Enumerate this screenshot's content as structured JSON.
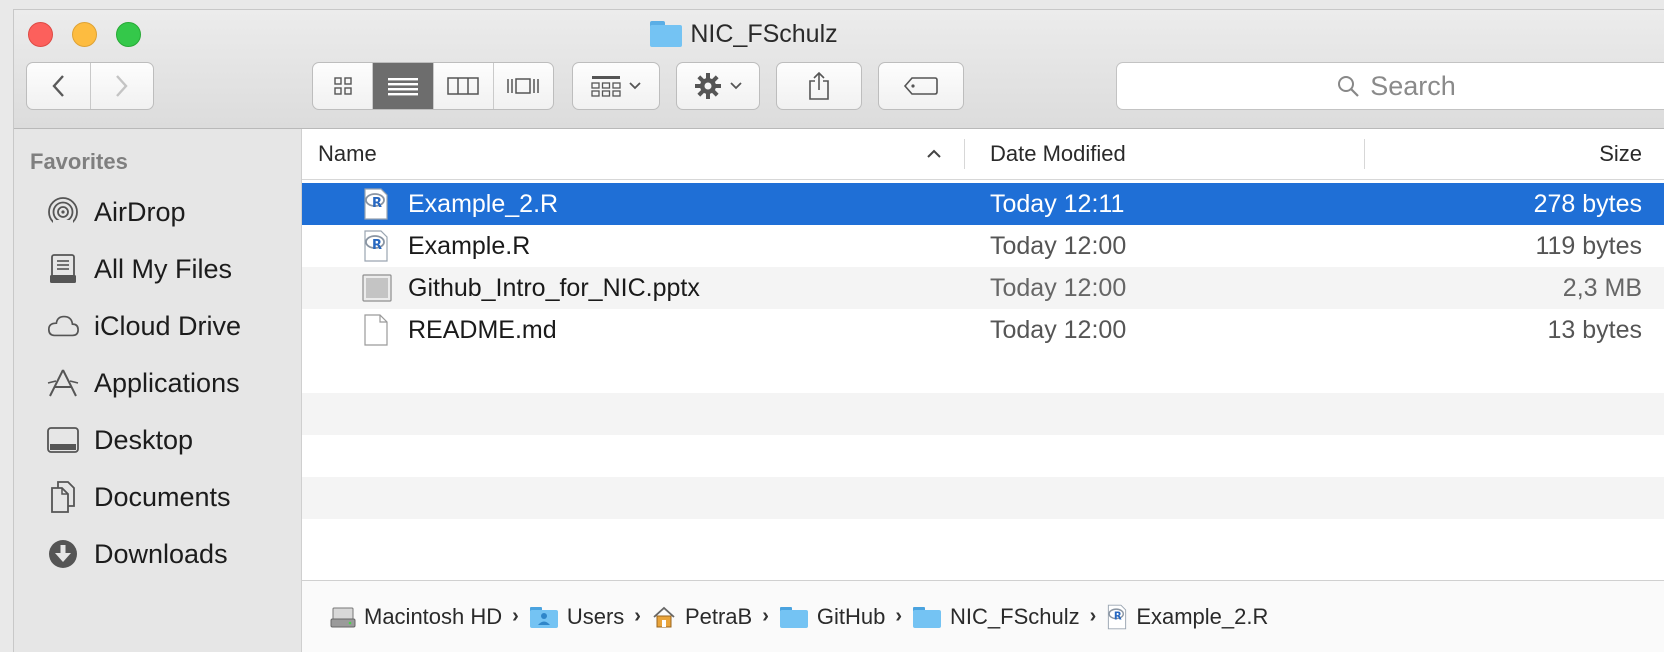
{
  "window": {
    "title": "NIC_FSchulz"
  },
  "toolbar": {
    "back_icon": "chevron-left-icon",
    "forward_icon": "chevron-right-icon",
    "view_modes": [
      "icon-view",
      "list-view",
      "column-view",
      "cover-flow-view"
    ],
    "active_view": "list-view",
    "search_placeholder": "Search"
  },
  "sidebar": {
    "heading": "Favorites",
    "items": [
      {
        "label": "AirDrop",
        "icon": "airdrop-icon"
      },
      {
        "label": "All My Files",
        "icon": "all-my-files-icon"
      },
      {
        "label": "iCloud Drive",
        "icon": "icloud-icon"
      },
      {
        "label": "Applications",
        "icon": "applications-icon"
      },
      {
        "label": "Desktop",
        "icon": "desktop-icon"
      },
      {
        "label": "Documents",
        "icon": "documents-icon"
      },
      {
        "label": "Downloads",
        "icon": "downloads-icon"
      }
    ]
  },
  "columns": {
    "name": "Name",
    "date": "Date Modified",
    "size": "Size",
    "sort_indicator": "^"
  },
  "files": [
    {
      "name": "Example_2.R",
      "date": "Today 12:11",
      "size": "278 bytes",
      "icon": "r-file-icon",
      "selected": true
    },
    {
      "name": "Example.R",
      "date": "Today 12:00",
      "size": "119 bytes",
      "icon": "r-file-icon",
      "selected": false
    },
    {
      "name": "Github_Intro_for_NIC.pptx",
      "date": "Today 12:00",
      "size": "2,3 MB",
      "icon": "pptx-file-icon",
      "selected": false
    },
    {
      "name": "README.md",
      "date": "Today 12:00",
      "size": "13 bytes",
      "icon": "document-file-icon",
      "selected": false
    }
  ],
  "pathbar": {
    "items": [
      {
        "label": "Macintosh HD",
        "icon": "hard-drive-icon"
      },
      {
        "label": "Users",
        "icon": "users-folder-icon"
      },
      {
        "label": "PetraB",
        "icon": "home-icon"
      },
      {
        "label": "GitHub",
        "icon": "folder-icon"
      },
      {
        "label": "NIC_FSchulz",
        "icon": "folder-icon"
      },
      {
        "label": "Example_2.R",
        "icon": "r-file-icon"
      }
    ],
    "separator": "›"
  },
  "colors": {
    "selection": "#1f6fd6",
    "folder": "#74c3f3"
  }
}
